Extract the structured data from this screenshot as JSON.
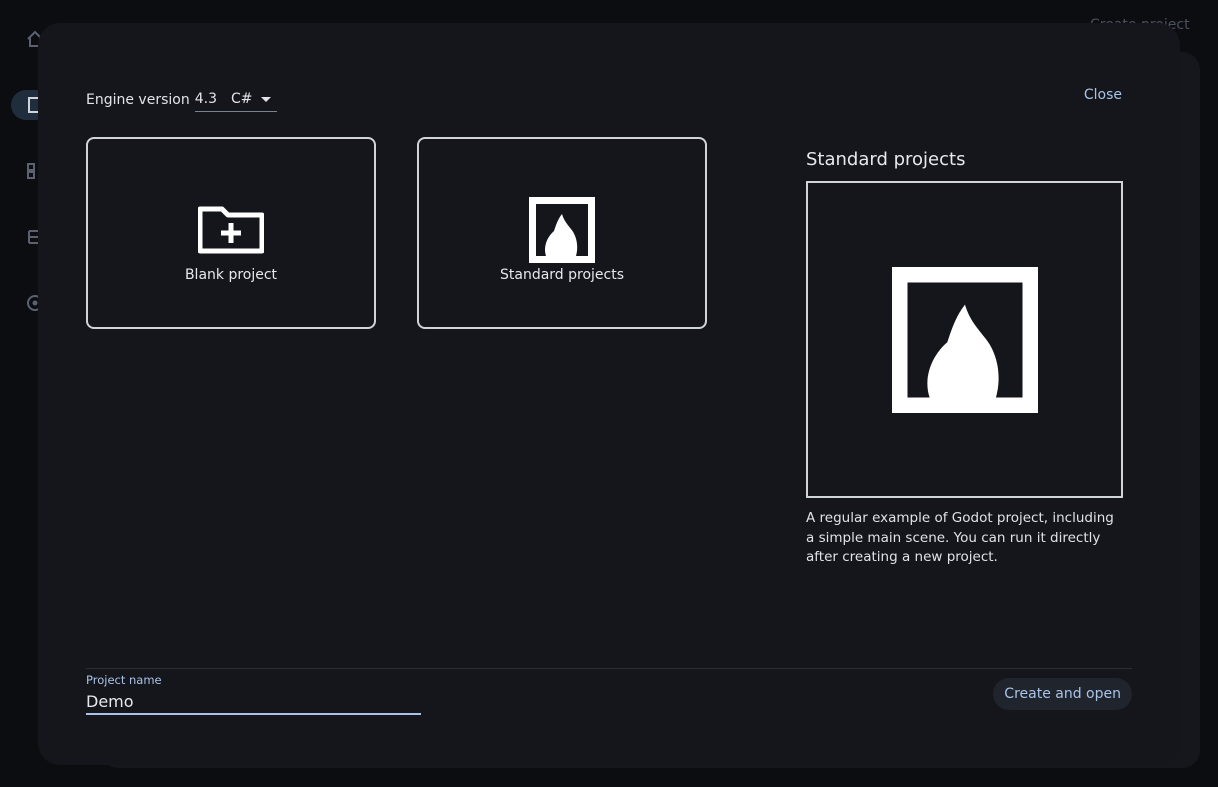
{
  "background": {
    "top_right_text": "Create project"
  },
  "dialog": {
    "engine_label": "Engine version",
    "engine_version": "4.3",
    "language": "C#",
    "close_label": "Close",
    "templates": [
      {
        "label": "Blank project",
        "icon": "folder-add-icon"
      },
      {
        "label": "Standard projects",
        "icon": "godot-fireplace-icon"
      }
    ],
    "preview": {
      "title": "Standard projects",
      "description": "A regular example of Godot project, including a simple main scene. You can run it directly after creating a new project."
    },
    "project_name_label": "Project name",
    "project_name_value": "Demo",
    "create_label": "Create and open"
  },
  "colors": {
    "accent": "#a9c3e8",
    "dialog_bg": "#14161b",
    "card_border": "#cfd3da"
  }
}
